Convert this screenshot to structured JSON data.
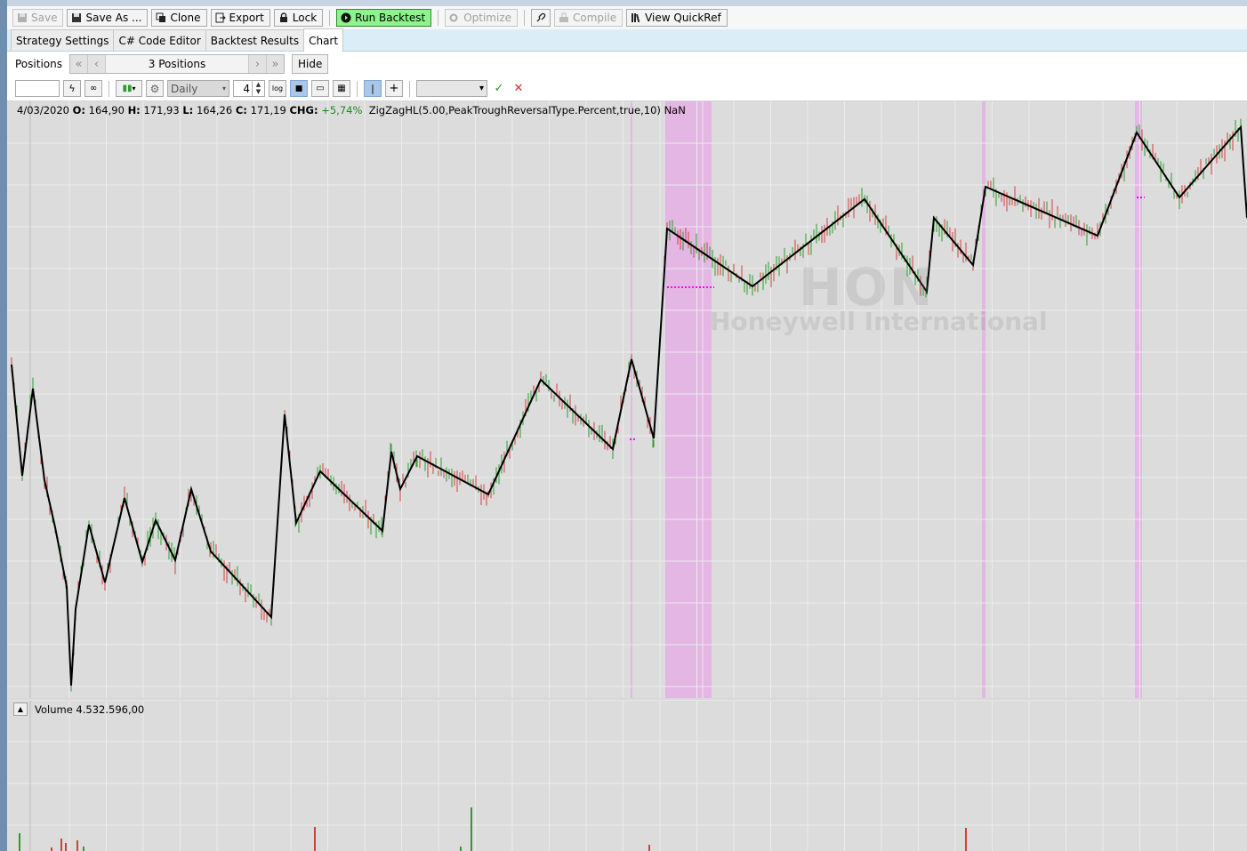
{
  "toolbar": {
    "save": "Save",
    "save_as": "Save As ...",
    "clone": "Clone",
    "export": "Export",
    "lock": "Lock",
    "run_backtest": "Run Backtest",
    "optimize": "Optimize",
    "compile": "Compile",
    "view_quickref": "View QuickRef"
  },
  "tabs": [
    "Strategy Settings",
    "C# Code Editor",
    "Backtest Results",
    "Chart"
  ],
  "active_tab": "Chart",
  "positions": {
    "label": "Positions",
    "count": "3 Positions",
    "hide": "Hide"
  },
  "chart_toolbar": {
    "scale": "Daily",
    "bars": "4",
    "log_label": "log"
  },
  "info": {
    "date": "4/03/2020",
    "o_label": "O:",
    "o": "164,90",
    "h_label": "H:",
    "h": "171,93",
    "l_label": "L:",
    "l": "164,26",
    "c_label": "C:",
    "c": "171,19",
    "chg_label": "CHG:",
    "chg": "+5,74%",
    "indicator": "ZigZagHL(5.00,PeakTroughReversalType.Percent,true,10) NaN"
  },
  "watermark": {
    "symbol": "HON",
    "name": "Honeywell International"
  },
  "volume": {
    "label": "Volume 4.532.596,00"
  },
  "colors": {
    "up": "#2e9b2e",
    "down": "#d04040",
    "highlight": "#e3b6e3",
    "zigzag": "#000000",
    "stop": "#ff00ff"
  },
  "chart_data": {
    "type": "line",
    "zigzag": [
      410,
      535,
      437,
      540,
      593,
      660,
      771,
      685,
      590,
      655,
      560,
      632,
      585,
      630,
      550,
      620,
      694,
      466,
      588,
      530,
      597,
      508,
      550,
      513,
      556,
      427,
      505,
      404,
      493,
      257,
      322,
      224,
      328,
      245,
      298,
      210,
      265,
      149,
      222,
      143,
      245
    ]
  }
}
